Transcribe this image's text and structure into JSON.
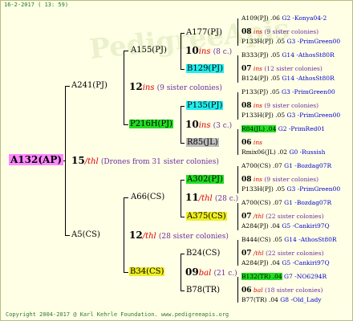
{
  "header_date": "16-2-2017 ( 13: 59)",
  "watermark": "PedigreeApis",
  "copyright": "Copyright 2004-2017 @ Karl Kehrle Foundation.   www.pedigreeapis.org",
  "root": {
    "name": "A132(AP)",
    "year": "15",
    "breed": "/thl",
    "sisters": "(Drones from 31 sister colonies)"
  },
  "g1": {
    "top": "A241(PJ)",
    "top_year": "12",
    "top_breed": "ins",
    "top_sisters": "(9 sister colonies)",
    "bottom": "A5(CS)",
    "bottom_year": "12",
    "bottom_breed": "/thl",
    "bottom_sisters": "(28 sister colonies)"
  },
  "g2": {
    "a": "A155(PJ)",
    "a_year": "10",
    "a_breed": "ins",
    "a_sis": "(8 c.)",
    "b": "P216H(PJ)",
    "b_year": "10",
    "b_breed": "ins",
    "b_sis": "(3 c.)",
    "c": "A66(CS)",
    "c_year": "11",
    "c_breed": "/thl",
    "c_sis": "(28 c.)",
    "d": "B34(CS)",
    "d_year": "09",
    "d_breed": "bal",
    "d_sis": "(21 c.)"
  },
  "g3": {
    "n1": "A177(PJ)",
    "n2": "B129(PJ)",
    "n3": "P135(PJ)",
    "n4": "R85(JL)",
    "n5": "A302(PJ)",
    "n6": "A375(CS)",
    "n7": "B24(CS)",
    "n8": "B78(TR)"
  },
  "refs": [
    {
      "text": "A109(PJ) .06",
      "code": "G2 -Konya04-2",
      "kind": "ref"
    },
    {
      "text": "08",
      "breed": "ins",
      "sis": "(9 sister colonies)",
      "kind": "yr"
    },
    {
      "text": "P133H(PJ) .05",
      "code": "G3 -PrimGreen00",
      "kind": "ref"
    },
    {
      "text": "B333(PJ) .05",
      "code": "G14 -AthosSt80R",
      "kind": "ref"
    },
    {
      "text": "07",
      "breed": "ins",
      "sis": "(12 sister colonies)",
      "kind": "yr"
    },
    {
      "text": "B124(PJ) .05",
      "code": "G14 -AthosSt80R",
      "kind": "ref"
    },
    {
      "text": "P133(PJ) .05",
      "code": "G3 -PrimGreen00",
      "kind": "ref"
    },
    {
      "text": "08",
      "breed": "ins",
      "sis": "(9 sister colonies)",
      "kind": "yr"
    },
    {
      "text": "P133H(PJ) .05",
      "code": "G3 -PrimGreen00",
      "kind": "ref"
    },
    {
      "text": "R84(JL) .04",
      "code": "G2 -PrimRed01",
      "kind": "ref",
      "hl": "#22dd22"
    },
    {
      "text": "06",
      "breed": "ins",
      "sis": "",
      "kind": "yr"
    },
    {
      "text": "Rmix06(JL) .02",
      "code": "G0 -Russish",
      "kind": "ref"
    },
    {
      "text": "A700(CS) .07",
      "code": "G1 -Bozdag07R",
      "kind": "ref"
    },
    {
      "text": "08",
      "breed": "ins",
      "sis": "(9 sister colonies)",
      "kind": "yr"
    },
    {
      "text": "P133H(PJ) .05",
      "code": "G3 -PrimGreen00",
      "kind": "ref"
    },
    {
      "text": "A700(CS) .07",
      "code": "G1 -Bozdag07R",
      "kind": "ref"
    },
    {
      "text": "07",
      "breed": "/thl",
      "sis": "(22 sister colonies)",
      "kind": "yr"
    },
    {
      "text": "A284(PJ) .04",
      "code": "G5 -Cankiri97Q",
      "kind": "ref"
    },
    {
      "text": "B444(CS) .05",
      "code": "G14 -AthosSt80R",
      "kind": "ref"
    },
    {
      "text": "07",
      "breed": "/thl",
      "sis": "(22 sister colonies)",
      "kind": "yr"
    },
    {
      "text": "A284(PJ) .04",
      "code": "G5 -Cankiri97Q",
      "kind": "ref"
    },
    {
      "text": "B132(TR) .04",
      "code": "G7 -NO6294R",
      "kind": "ref",
      "hl": "#22dd22"
    },
    {
      "text": "06",
      "breed": "bal",
      "sis": "(18 sister colonies)",
      "kind": "yr"
    },
    {
      "text": "B77(TR) .04",
      "code": "G8 -Old_Lady",
      "kind": "ref"
    }
  ]
}
